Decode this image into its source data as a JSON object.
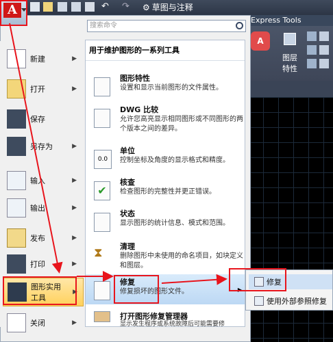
{
  "qat": {
    "workspace": "草图与注释"
  },
  "ribbon": {
    "express_tab": "Express Tools",
    "layer_props": "图层\n特性"
  },
  "search": {
    "placeholder": "搜索命令"
  },
  "left_menu": [
    {
      "label": "新建",
      "chev": "▶"
    },
    {
      "label": "打开",
      "chev": "▶"
    },
    {
      "label": "保存",
      "chev": ""
    },
    {
      "label": "另存为",
      "chev": "▶"
    },
    {
      "label": "输入",
      "chev": "▶"
    },
    {
      "label": "输出",
      "chev": "▶"
    },
    {
      "label": "发布",
      "chev": "▶"
    },
    {
      "label": "打印",
      "chev": "▶"
    },
    {
      "label": "图形实用\n工具",
      "chev": "▶"
    },
    {
      "label": "关闭",
      "chev": "▶"
    }
  ],
  "submenu": {
    "title": "用于维护图形的一系列工具",
    "items": [
      {
        "title": "图形特性",
        "desc": "设置和显示当前图形的文件属性。"
      },
      {
        "title": "DWG 比较",
        "desc": "允许您高亮显示相同图形或不同图形的两个版本之间的差异。"
      },
      {
        "title": "单位",
        "desc": "控制坐标及角度的显示格式和精度。"
      },
      {
        "title": "核查",
        "desc": "检查图形的完整性并更正错误。"
      },
      {
        "title": "状态",
        "desc": "显示图形的统计信息、模式和范围。"
      },
      {
        "title": "清理",
        "desc": "删除图形中未使用的命名项目，如块定义和图层。"
      },
      {
        "title": "修复",
        "desc": "修复损坏的图形文件。"
      },
      {
        "title": "打开图形修复管理器",
        "desc": "显示发生程序或系统故障后可能需要修"
      }
    ]
  },
  "flyout": {
    "items": [
      "修复",
      "使用外部参照修复"
    ]
  },
  "colors": {
    "accent_red": "#e8141c",
    "highlight_blue": "#bcd8f4",
    "selected_gold": "#ffd15c"
  }
}
